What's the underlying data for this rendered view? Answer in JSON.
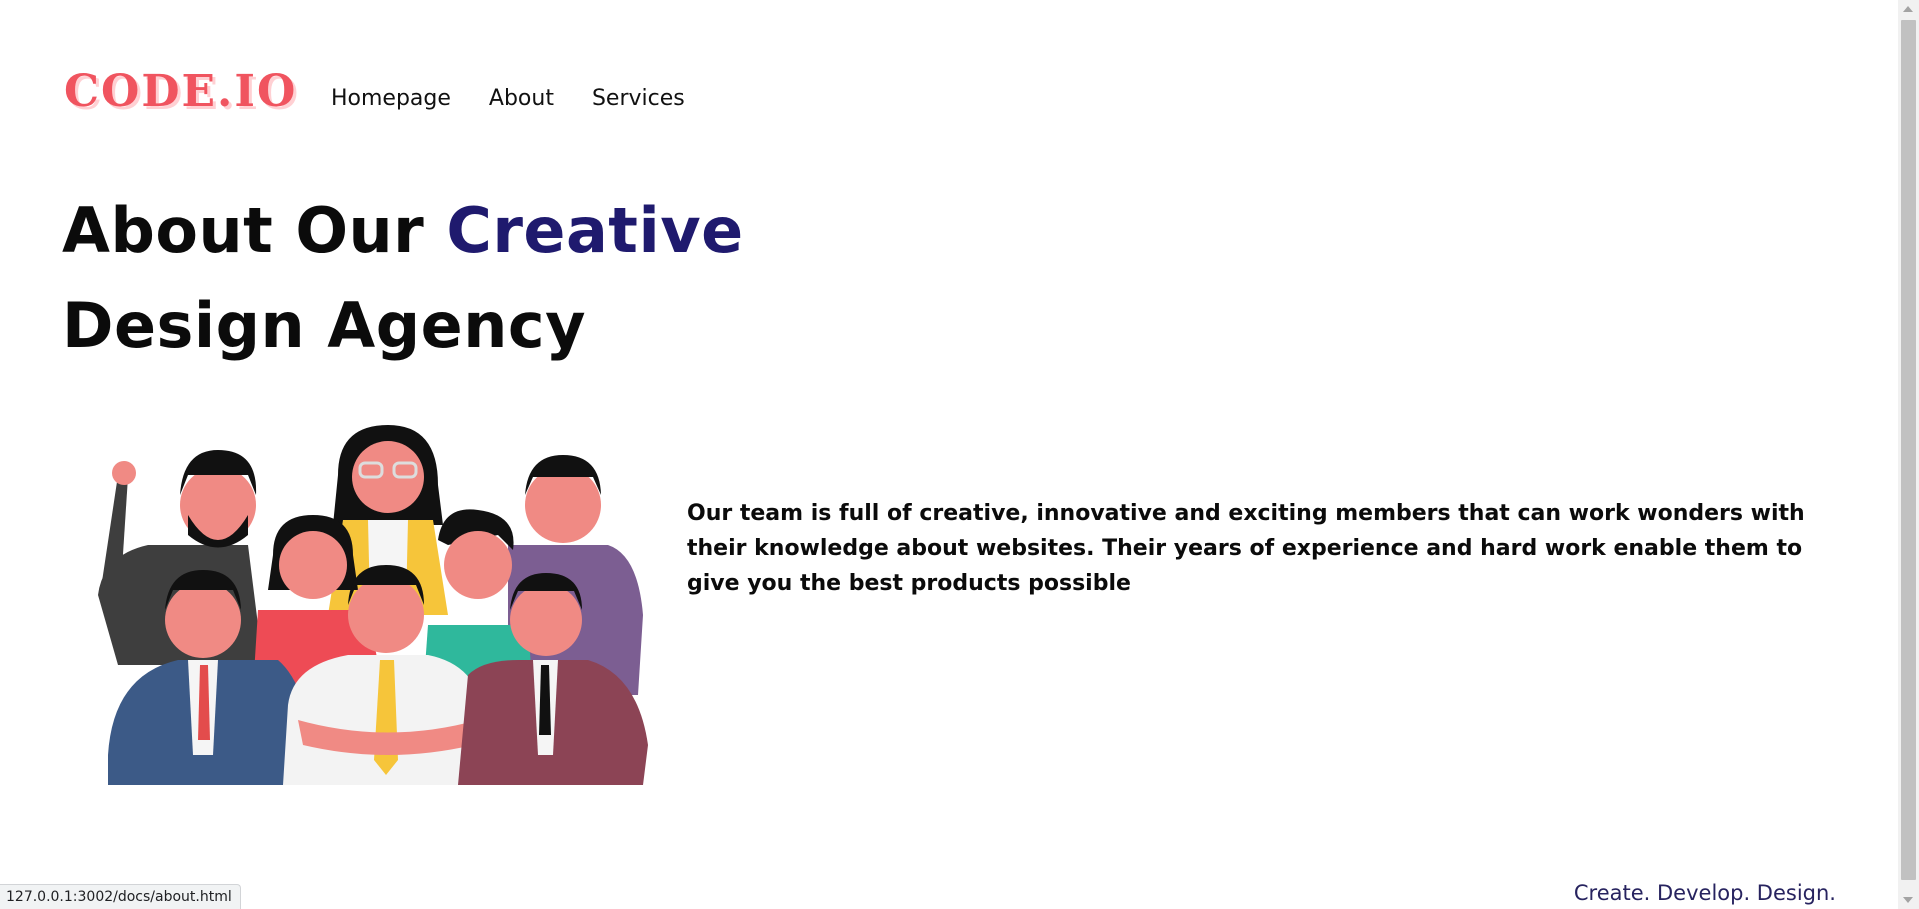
{
  "header": {
    "logo": "CODE.IO",
    "nav": [
      "Homepage",
      "About",
      "Services"
    ]
  },
  "hero": {
    "title_part1": "About Our",
    "title_accent": "Creative",
    "title_line2": "Design Agency"
  },
  "about": {
    "description": "Our team is full of creative, innovative and exciting members that can work wonders with their knowledge about websites. Their years of experience and hard work enable them to give you the best products possible"
  },
  "footer": {
    "tagline": "Create. Develop. Design."
  },
  "statusbar": {
    "url": "127.0.0.1:3002/docs/about.html"
  },
  "colors": {
    "logo": "#f0545f",
    "accent": "#1f1a6e",
    "tagline": "#27235f"
  }
}
